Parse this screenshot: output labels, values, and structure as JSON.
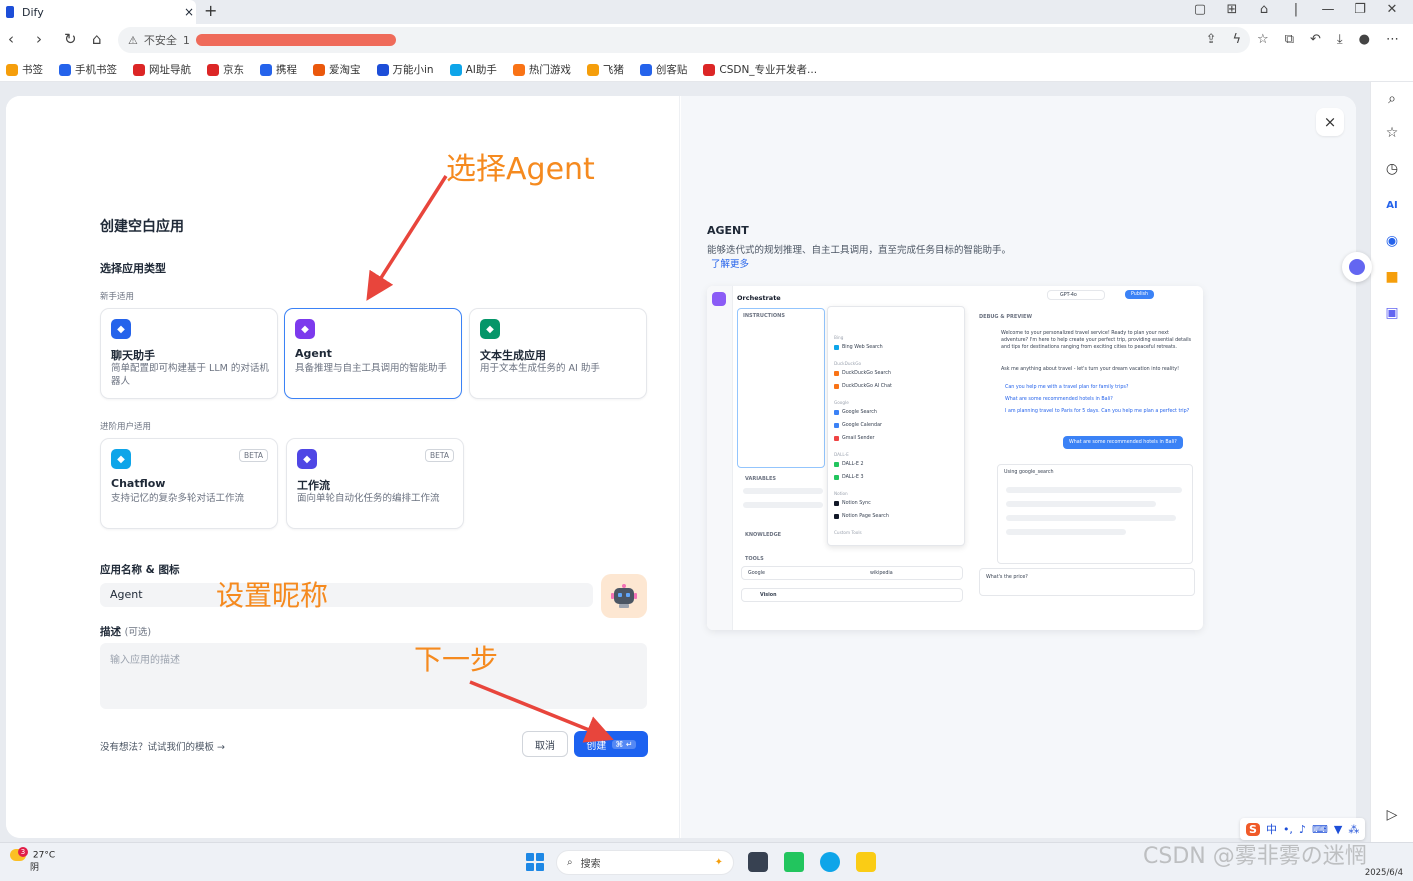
{
  "browser": {
    "tab_title": "Dify",
    "tab_close": "×",
    "new_tab": "+",
    "insecure_label": "不安全",
    "url_prefix": "1",
    "bookmarks": [
      {
        "label": "书签",
        "color": "#f59e0b"
      },
      {
        "label": "手机书签",
        "color": "#2563eb"
      },
      {
        "label": "网址导航",
        "color": "#dc2626"
      },
      {
        "label": "京东",
        "color": "#dc2626"
      },
      {
        "label": "携程",
        "color": "#2563eb"
      },
      {
        "label": "爱淘宝",
        "color": "#ea580c"
      },
      {
        "label": "万能小in",
        "color": "#1d4ed8"
      },
      {
        "label": "AI助手",
        "color": "#0ea5e9"
      },
      {
        "label": "热门游戏",
        "color": "#f97316"
      },
      {
        "label": "飞猪",
        "color": "#f59e0b"
      },
      {
        "label": "创客贴",
        "color": "#2563eb"
      },
      {
        "label": "CSDN_专业开发者...",
        "color": "#dc2626"
      }
    ]
  },
  "modal": {
    "title": "创建空白应用",
    "type_heading": "选择应用类型",
    "beginner_label": "新手适用",
    "advanced_label": "进阶用户适用",
    "close": "×",
    "cards_beginner": [
      {
        "name": "聊天助手",
        "desc": "简单配置即可构建基于 LLM 的对话机器人",
        "icon_color": "#2563eb",
        "selected": false
      },
      {
        "name": "Agent",
        "desc": "具备推理与自主工具调用的智能助手",
        "icon_color": "#7c3aed",
        "selected": true
      },
      {
        "name": "文本生成应用",
        "desc": "用于文本生成任务的 AI 助手",
        "icon_color": "#059669",
        "selected": false
      }
    ],
    "cards_advanced": [
      {
        "name": "Chatflow",
        "desc": "支持记忆的复杂多轮对话工作流",
        "beta": "BETA",
        "icon_color": "#0ea5e9"
      },
      {
        "name": "工作流",
        "desc": "面向单轮自动化任务的编排工作流",
        "beta": "BETA",
        "icon_color": "#4f46e5"
      }
    ],
    "name_label": "应用名称 & 图标",
    "name_value": "Agent",
    "desc_label": "描述",
    "desc_optional": "(可选)",
    "desc_placeholder": "输入应用的描述",
    "template_link": "没有想法？试试我们的模板 →",
    "cancel": "取消",
    "create": "创建",
    "create_kbd": "⌘ ↵"
  },
  "annotations": {
    "select_agent": "选择Agent",
    "set_nickname": "设置昵称",
    "next_step": "下一步",
    "color": "#f58a1f",
    "arrow_color": "#e8453c"
  },
  "preview": {
    "title": "AGENT",
    "desc": "能够迭代式的规划推理、自主工具调用，直至完成任务目标的智能助手。",
    "learn_more": "了解更多",
    "orchestrate": "Orchestrate",
    "instructions": "INSTRUCTIONS",
    "variables": "VARIABLES",
    "knowledge": "KNOWLEDGE",
    "tools": "TOOLS",
    "vision": "Vision",
    "debug_preview": "DEBUG & PREVIEW",
    "publish": "Publish",
    "model": "GPT-4o",
    "tool_categories": [
      "Bing",
      "DuckDuckGo",
      "Google",
      "DALL-E",
      "Notion",
      "Custom Tools"
    ],
    "tool_items": [
      "Bing Web Search",
      "DuckDuckGo Search",
      "DuckDuckGo AI Chat",
      "Google Search",
      "Google Calendar",
      "Gmail Sender",
      "DALL-E 2",
      "DALL-E 3",
      "Notion Sync",
      "Notion Page Search"
    ],
    "chat_welcome": "Welcome to your personalized travel service! Ready to plan your next adventure? I'm here to help create your perfect trip, providing essential details and tips for destinations ranging from exciting cities to peaceful retreats.",
    "chat_ask": "Ask me anything about travel - let's turn your dream vacation into reality!",
    "chat_q1": "Can you help me with a travel plan for family trips?",
    "chat_q2": "What are some recommended hotels in Bali?",
    "chat_q3": "I am planning travel to Paris for 5 days. Can you help me plan a perfect trip?",
    "user_msg": "What are some recommended hotels in Bali?",
    "using_tool": "Using google_search",
    "input_text": "What's the price?",
    "tool_google": "Google",
    "tool_wikipedia": "wikipedia"
  },
  "taskbar": {
    "badge": "3",
    "temp": "27°C",
    "weather": "阴",
    "search": "搜索",
    "date": "2025/6/4"
  },
  "ime": {
    "logo": "S",
    "mode": "中"
  },
  "watermark": "CSDN @雾非雾の迷惘"
}
